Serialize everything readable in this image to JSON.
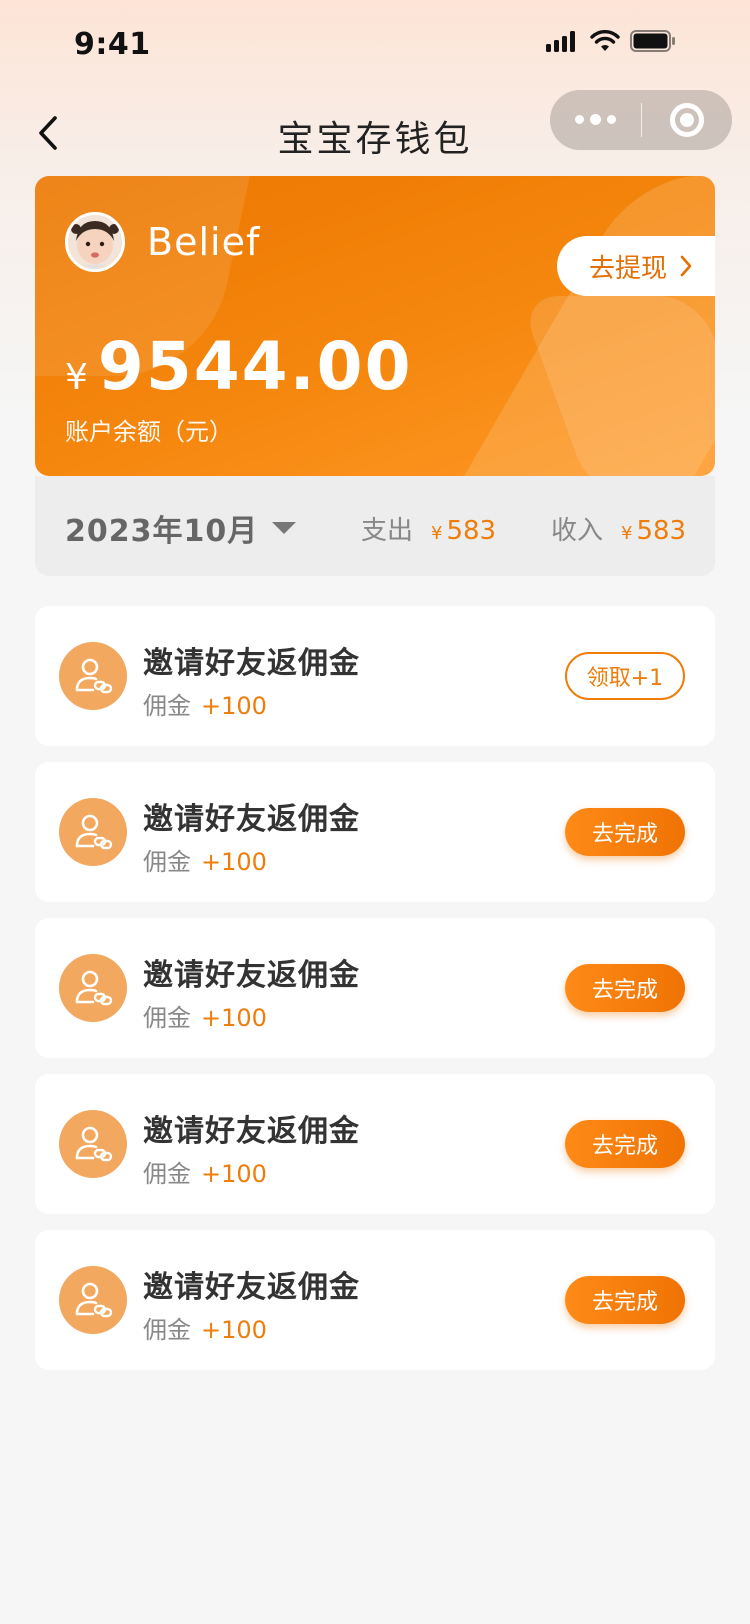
{
  "status_bar": {
    "time": "9:41"
  },
  "nav": {
    "title": "宝宝存钱包"
  },
  "card": {
    "user_name": "Belief",
    "withdraw_label": "去提现",
    "currency": "¥",
    "amount": "9544.00",
    "amount_label": "账户余额（元）"
  },
  "summary": {
    "month": "2023年10月",
    "expense_label": "支出",
    "expense_currency": "¥",
    "expense_value": "583",
    "income_label": "收入",
    "income_currency": "¥",
    "income_value": "583"
  },
  "tasks": [
    {
      "title": "邀请好友返佣金",
      "reward_label": "佣金",
      "reward_value": "+100",
      "button": "领取+1",
      "button_type": "claim"
    },
    {
      "title": "邀请好友返佣金",
      "reward_label": "佣金",
      "reward_value": "+100",
      "button": "去完成",
      "button_type": "todo"
    },
    {
      "title": "邀请好友返佣金",
      "reward_label": "佣金",
      "reward_value": "+100",
      "button": "去完成",
      "button_type": "todo"
    },
    {
      "title": "邀请好友返佣金",
      "reward_label": "佣金",
      "reward_value": "+100",
      "button": "去完成",
      "button_type": "todo"
    },
    {
      "title": "邀请好友返佣金",
      "reward_label": "佣金",
      "reward_value": "+100",
      "button": "去完成",
      "button_type": "todo"
    }
  ],
  "icons": {
    "back": "chevron-left-icon",
    "more": "more-dots-icon",
    "close": "target-circle-icon",
    "withdraw_arrow": "chevron-right-icon",
    "month_caret": "caret-down-icon",
    "task": "user-invite-icon"
  },
  "colors": {
    "accent": "#ef7d0b",
    "card_start": "#ec7700",
    "card_end": "#ff9826",
    "task_icon_bg": "#f2a85e"
  }
}
